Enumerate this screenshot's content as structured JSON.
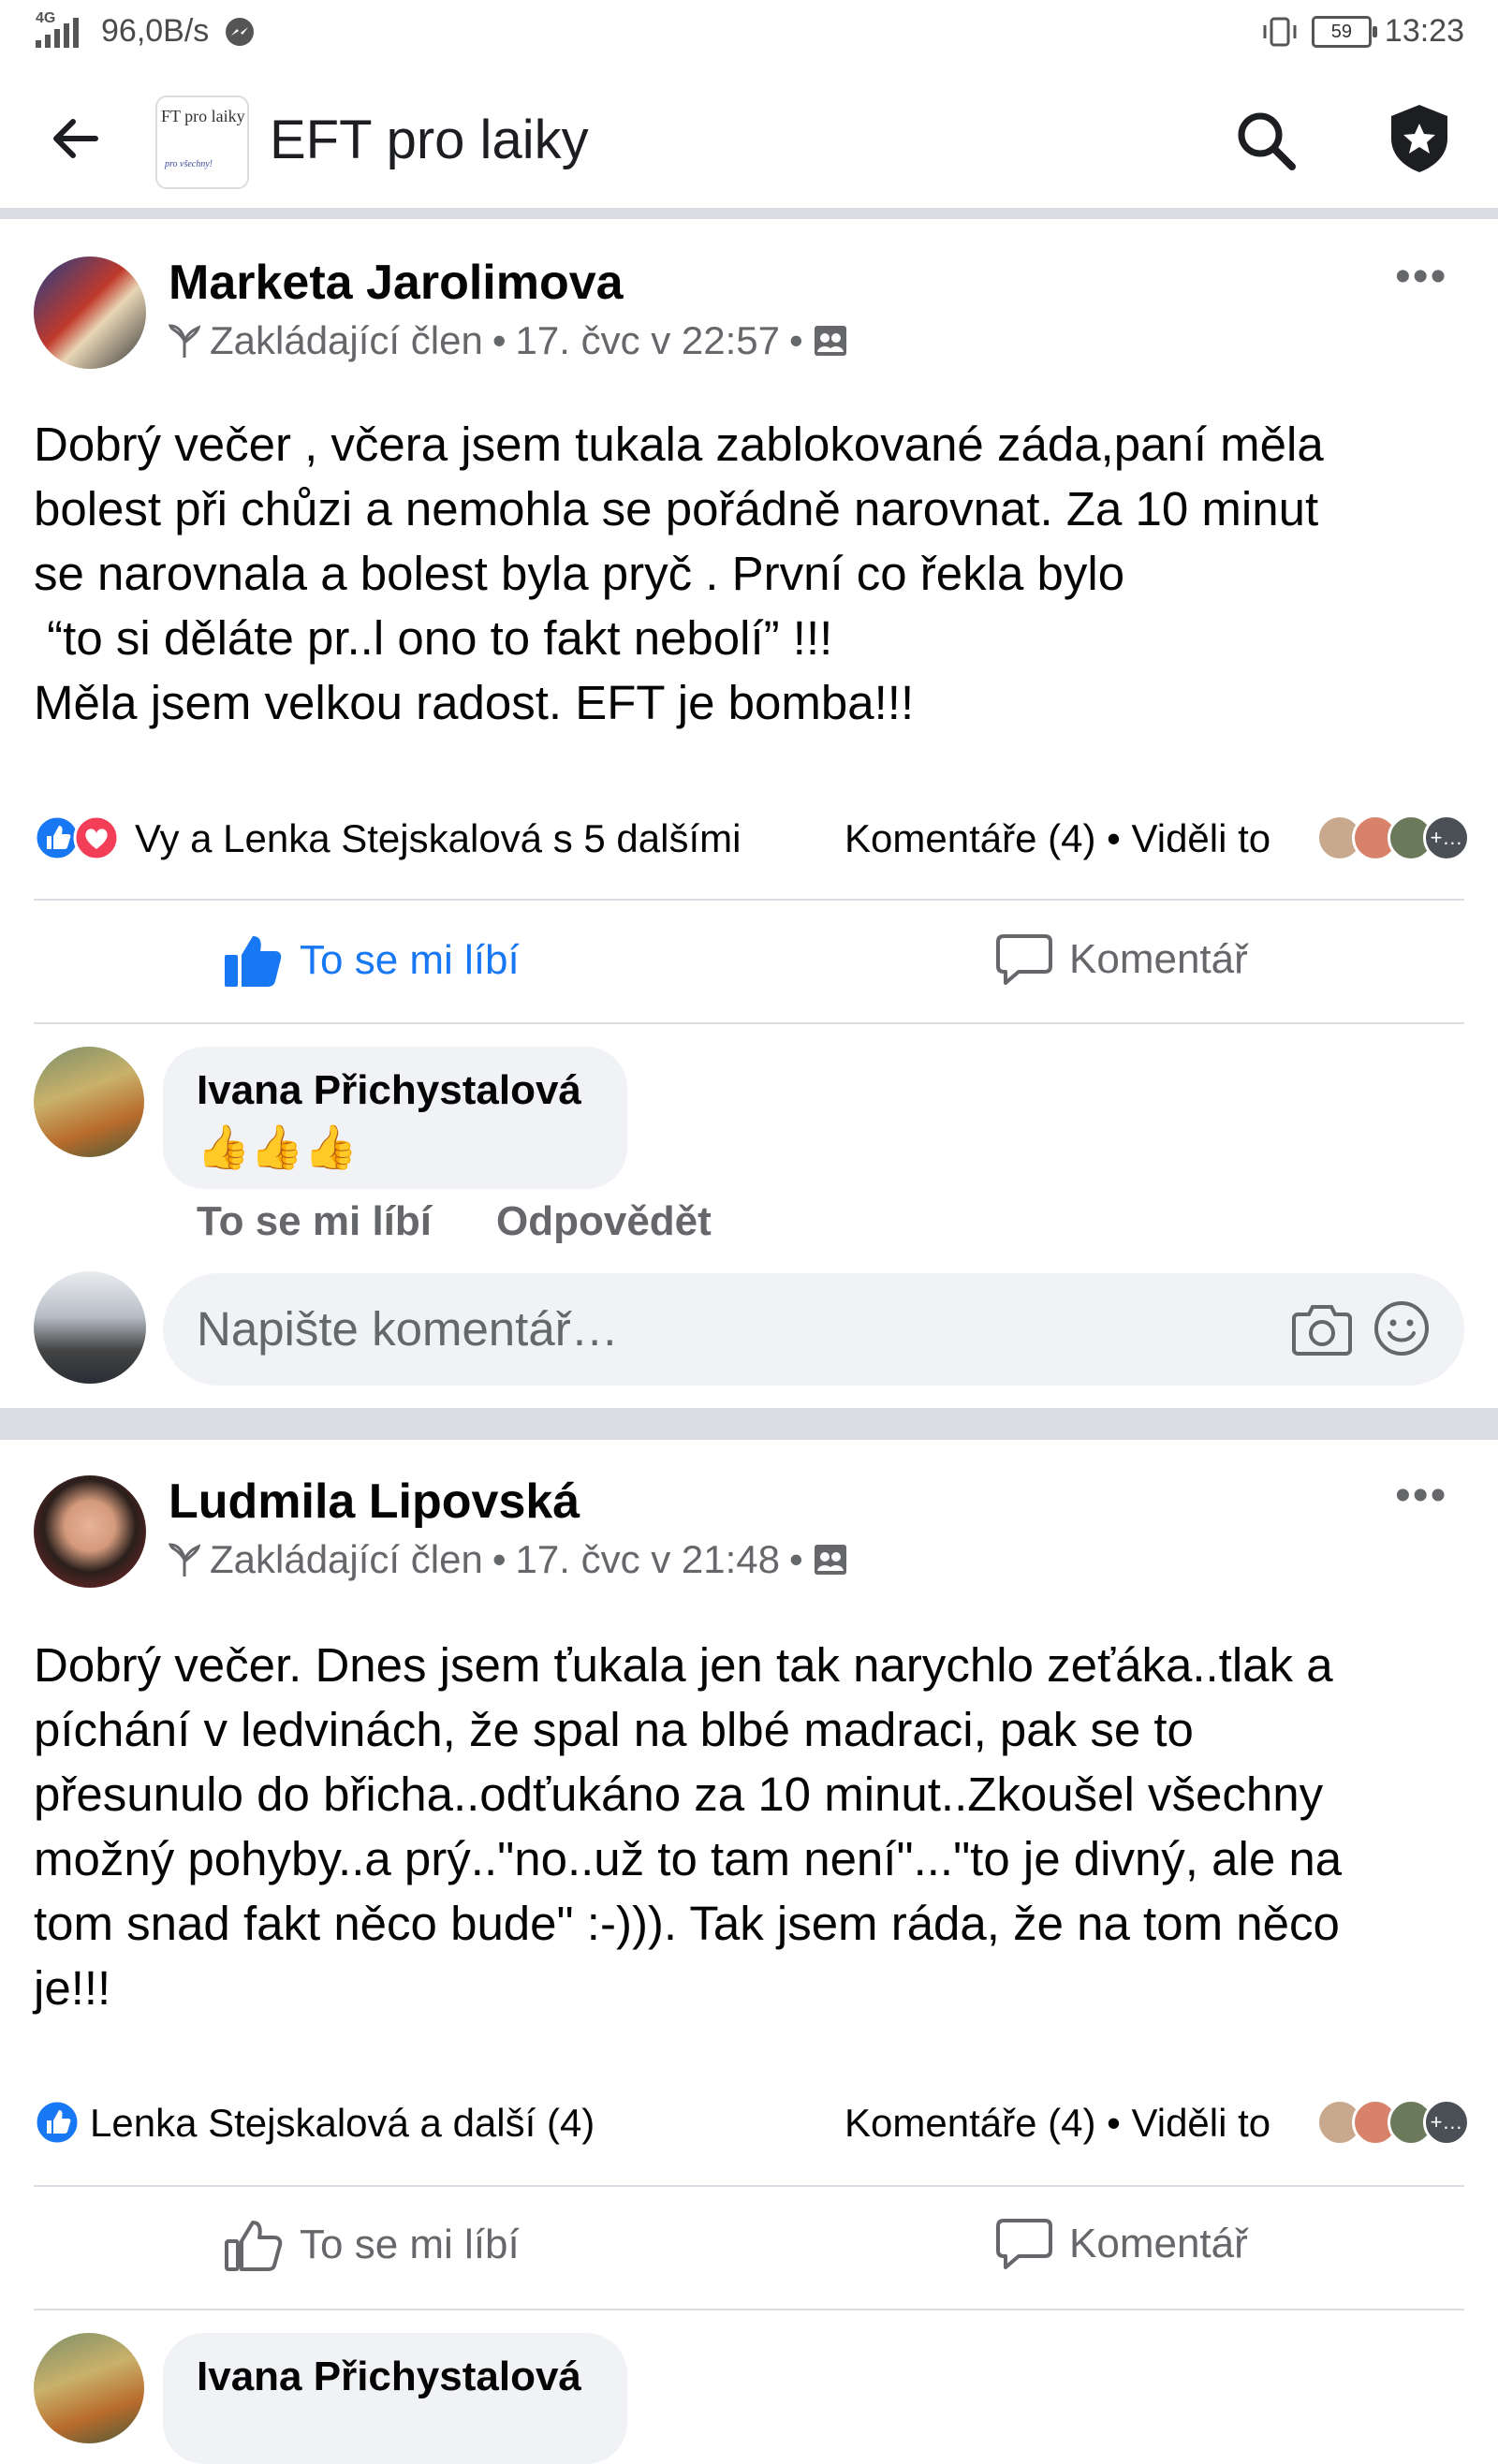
{
  "status_bar": {
    "network": "4G",
    "speed": "96,0B/s",
    "battery": "59",
    "time": "13:23"
  },
  "header": {
    "group_logo_top": "FT pro laiky",
    "group_logo_bottom": "pro všechny!",
    "title": "EFT pro laiky"
  },
  "posts": [
    {
      "author": "Marketa Jarolimova",
      "badge": "Zakládající člen",
      "time": "17. čvc v 22:57",
      "text": "Dobrý večer , včera jsem tukala zablokované záda,paní měla\nbolest při chůzi a nemohla se pořádně narovnat. Za 10 minut\nse narovnala a bolest byla pryč . První co řekla bylo\n “to si děláte pr..l ono to fakt nebolí” !!!\nMěla jsem velkou radost. EFT je bomba!!!",
      "reactions_text": "Vy a Lenka Stejskalová s 5 dalšími",
      "comments_text": "Komentáře (4) • Viděli to",
      "like_label": "To se mi líbí",
      "comment_label": "Komentář",
      "liked": true,
      "comment": {
        "author": "Ivana Přichystalová",
        "body": "👍👍👍",
        "like": "To se mi líbí",
        "reply": "Odpovědět"
      },
      "compose_placeholder": "Napište komentář…"
    },
    {
      "author": "Ludmila Lipovská",
      "badge": "Zakládající člen",
      "time": "17. čvc v 21:48",
      "text": "Dobrý večer. Dnes jsem ťukala jen tak narychlo zeťáka..tlak a\npíchání v ledvinách, že spal na blbé madraci, pak se to\npřesunulo do břicha..odťukáno za 10 minut..Zkoušel všechny\nmožný pohyby..a prý..\"no..už to tam není\"...\"to je divný, ale na\ntom snad fakt něco bude\" :-))). Tak jsem ráda, že na tom něco\nje!!!",
      "reactions_text": "Lenka Stejskalová a další (4)",
      "comments_text": "Komentáře (4) • Viděli to",
      "like_label": "To se mi líbí",
      "comment_label": "Komentář",
      "liked": false,
      "comment": {
        "author": "Ivana Přichystalová"
      }
    }
  ],
  "colors": {
    "fb_blue": "#1877f2",
    "gray_text": "#65676b",
    "divider": "#dadde1",
    "bubble": "#f0f2f5"
  }
}
